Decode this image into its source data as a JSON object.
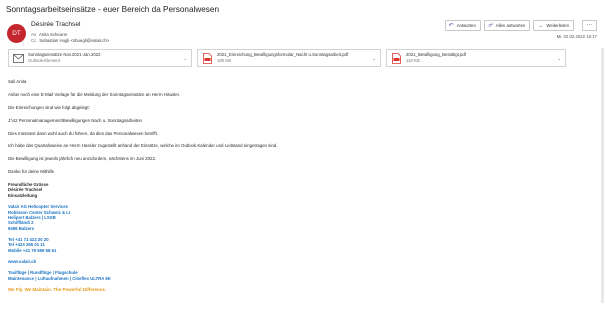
{
  "email": {
    "subject": "Sonntagsarbeitseinsätze - euer Bereich da Personalwesen",
    "sender_initials": "DT",
    "sender_name": "Désirée Trachsel",
    "to_key": "An",
    "to_value": "Anita Scheurer",
    "cc_key": "Cc",
    "cc_value": "Sebastian Hugli <shuegli@valair.ch>",
    "date": "Mi. 02.02.2022 16:17"
  },
  "actions": {
    "reply": "Antworten",
    "reply_all": "Allen antworten",
    "forward": "Weiterleiten",
    "more": "···"
  },
  "attachments": [
    {
      "name": "Sonntagseinsätze Nov.2021-Jan.2022",
      "meta": "Outlook-Element",
      "icon": "mail-icon"
    },
    {
      "name": "2021_Einreichung_Bewilligungsformular_Nacht u.Sonntagsarbeit.pdf",
      "meta": "190 KB",
      "icon": "pdf-icon"
    },
    {
      "name": "2021_Bewilligung_Bestätigt.pdf",
      "meta": "110 KB",
      "icon": "pdf-icon"
    }
  ],
  "body": {
    "greeting": "Sali Anita",
    "p1": "Anbei noch eine E-Mail Vorlage für die Meldung der Sonntagseinsätze an Herrn Häusler.",
    "p2": "Die Einreichungen sind wie folgt abgelegt:",
    "p3": "J:\\42 Personalmanagement\\Bewilligungen Nach u. Sonntagsarbeiten",
    "p4": "Dies müsstest dann wohl auch du führen, da dies das Personalwesen betrifft.",
    "p5": "Ich habe das Quartalsweise an Herrn Hassler zugestellt anhand der Einsätze, welche im Outlook Kalender und Leitstand eingetragen sind.",
    "p6": "Die Bewilligung ist jeweils jährlich neu anzufordern, nächstens im Juni 2022.",
    "p7": "Danke für deine Mithilfe"
  },
  "signature": {
    "closing": "Freundliche Grüsse",
    "name": "Désirée Trachsel",
    "role": "Einsatzleitung",
    "company": "Valair AG Helicopter Services",
    "partner": "Robinson Center Schweiz & LI",
    "location": "Heliport Balzers | LSXB",
    "street": "Schiffländi 2",
    "city": "9496 Balzers",
    "tel": "Tel +41 71 422 20 20",
    "tel2": "Tel +423 265 01 11",
    "mobile": "Mobile +41 79 559 58 61",
    "web": "www.valair.ch",
    "services1": "Taxiflüge | Rundflüge | Flugschule",
    "services2": "Maintenance | Luftaufnahmen | Cineflex ULTRA 6K",
    "slogan": "We Fly. We Maintain. The Powerful Difference."
  },
  "colors": {
    "avatar": "#c4262e",
    "link_blue": "#1a73c4",
    "slogan_orange": "#e69a1a",
    "action_icon": "#6b4fa5",
    "pdf_red": "#d9352e"
  }
}
